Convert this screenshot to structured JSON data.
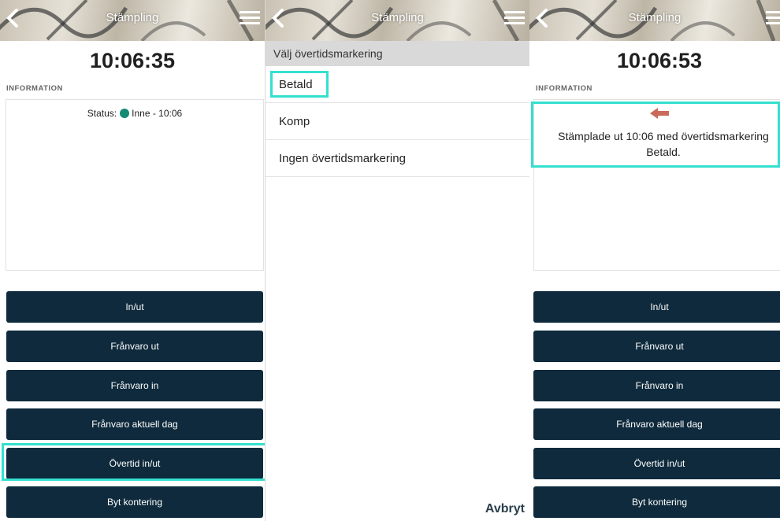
{
  "header": {
    "title": "Stämpling"
  },
  "panel1": {
    "clock": "10:06:35",
    "info_label": "INFORMATION",
    "status_label": "Status:",
    "status_value": "Inne - 10:06",
    "buttons": [
      "In/ut",
      "Frånvaro ut",
      "Frånvaro in",
      "Frånvaro aktuell dag",
      "Övertid in/ut",
      "Byt kontering"
    ]
  },
  "panel2": {
    "list_title": "Välj övertidsmarkering",
    "options": [
      "Betald",
      "Komp",
      "Ingen övertidsmarkering"
    ],
    "cancel": "Avbryt"
  },
  "panel3": {
    "clock": "10:06:53",
    "info_label": "INFORMATION",
    "message": "Stämplade ut 10:06 med övertidsmarkering Betald.",
    "buttons": [
      "In/ut",
      "Frånvaro ut",
      "Frånvaro in",
      "Frånvaro aktuell dag",
      "Övertid in/ut",
      "Byt kontering"
    ]
  },
  "colors": {
    "button_bg": "#0e2a3c",
    "highlight": "#34e0cf",
    "status_dot": "#138a73",
    "arrow": "#c96a5a"
  },
  "icons": [
    "back-chevron-icon",
    "hamburger-menu-icon",
    "arrow-left-icon"
  ]
}
